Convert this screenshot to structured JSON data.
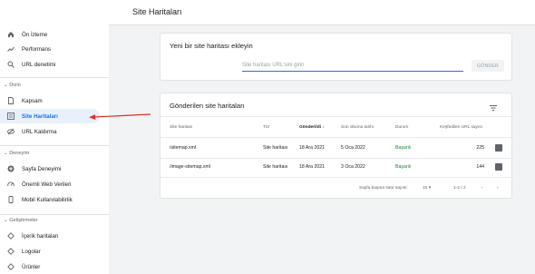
{
  "header": {
    "title": "Site Haritaları"
  },
  "sidebar": {
    "items": [
      {
        "label": "Ön İzleme",
        "icon": "home-icon"
      },
      {
        "label": "Performans",
        "icon": "trending-up-icon"
      },
      {
        "label": "URL denetimi",
        "icon": "search-icon"
      }
    ],
    "section_index": {
      "label": "Dizin"
    },
    "index_items": [
      {
        "label": "Kapsam",
        "icon": "file-icon"
      },
      {
        "label": "Site Haritaları",
        "icon": "sitemap-icon",
        "active": true
      },
      {
        "label": "URL Kaldırma",
        "icon": "eye-off-icon"
      }
    ],
    "section_experience": {
      "label": "Deneyim"
    },
    "experience_items": [
      {
        "label": "Sayfa Deneyimi",
        "icon": "add-circle-icon"
      },
      {
        "label": "Önemli Web Verileri",
        "icon": "speed-icon"
      },
      {
        "label": "Mobil Kullanılabilirlik",
        "icon": "phone-icon"
      }
    ],
    "section_enhancements": {
      "label": "Geliştirmeler"
    },
    "enhancement_items": [
      {
        "label": "İçerik haritaları",
        "icon": "layers-icon"
      },
      {
        "label": "Logolar",
        "icon": "layers-icon"
      },
      {
        "label": "Ürünler",
        "icon": "layers-icon"
      }
    ]
  },
  "add_sitemap": {
    "title": "Yeni bir site haritası ekleyin",
    "input_placeholder": "Site haritası URL'sini girin",
    "submit_label": "GÖNDER"
  },
  "submitted": {
    "title": "Gönderilen site haritaları",
    "columns": [
      "Site haritası",
      "Tür",
      "Gönderildi",
      "Son okuma tarihi",
      "Durum",
      "Keşfedilen URL sayısı"
    ],
    "rows": [
      {
        "sitemap": "/sitemap.xml",
        "type": "Site haritası",
        "submitted": "18 Ara 2021",
        "last_read": "5 Oca 2022",
        "status": "Başarılı",
        "urls": "225"
      },
      {
        "sitemap": "/image-sitemap.xml",
        "type": "Site haritası",
        "submitted": "18 Ara 2021",
        "last_read": "3 Oca 2022",
        "status": "Başarılı",
        "urls": "144"
      }
    ],
    "pager": {
      "rows_per_page_label": "Sayfa başına satır sayısı:",
      "rows_per_page": "10",
      "range": "1-2 / 2"
    }
  },
  "colors": {
    "accent": "#1a73e8",
    "success": "#188038",
    "annotation_arrow": "#d93025"
  }
}
